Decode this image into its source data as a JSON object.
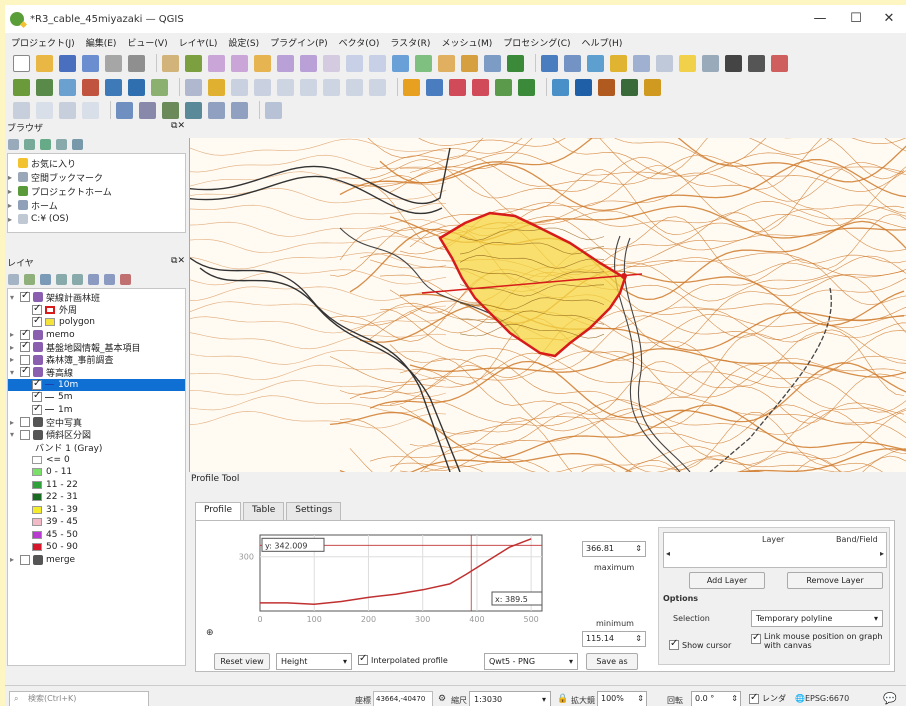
{
  "window": {
    "title": "*R3_cable_45miyazaki — QGIS",
    "minimize": "—",
    "maximize": "☐",
    "close": "✕"
  },
  "menu": [
    "プロジェクト(J)",
    "編集(E)",
    "ビュー(V)",
    "レイヤ(L)",
    "設定(S)",
    "プラグイン(P)",
    "ベクタ(O)",
    "ラスタ(R)",
    "メッシュ(M)",
    "プロセシング(C)",
    "ヘルプ(H)"
  ],
  "browser": {
    "title": "ブラウザ",
    "items": [
      "お気に入り",
      "空間ブックマーク",
      "プロジェクトホーム",
      "ホーム",
      "C:¥ (OS)"
    ]
  },
  "layers": {
    "title": "レイヤ",
    "rows": [
      {
        "label": "架線計画林班",
        "depth": 0,
        "checked": true,
        "expander": "▾",
        "icon": "#8a5fb0"
      },
      {
        "label": "外周",
        "depth": 1,
        "checked": true,
        "swatch": "outline-red"
      },
      {
        "label": "polygon",
        "depth": 1,
        "checked": true,
        "swatch": "#f3e33a"
      },
      {
        "label": "memo",
        "depth": 0,
        "checked": true,
        "expander": "▸",
        "icon": "#8a5fb0"
      },
      {
        "label": "基盤地図情報_基本項目",
        "depth": 0,
        "checked": true,
        "expander": "▸",
        "icon": "#8a5fb0"
      },
      {
        "label": "森林簿_事前調査",
        "depth": 0,
        "checked": false,
        "expander": "▸",
        "icon": "#8a5fb0"
      },
      {
        "label": "等高線",
        "depth": 0,
        "checked": true,
        "expander": "▾",
        "icon": "#8a5fb0"
      },
      {
        "label": "10m",
        "depth": 1,
        "checked": true,
        "selected": true,
        "line": "#1e40b0"
      },
      {
        "label": "5m",
        "depth": 1,
        "checked": true,
        "line": "#444444"
      },
      {
        "label": "1m",
        "depth": 1,
        "checked": true,
        "line": "#444444"
      },
      {
        "label": "空中写真",
        "depth": 0,
        "checked": false,
        "expander": "▸",
        "icon": "#555555"
      },
      {
        "label": "傾斜区分図",
        "depth": 0,
        "checked": false,
        "expander": "▾",
        "icon": "#555555"
      },
      {
        "label": "バンド 1 (Gray)",
        "depth": 1,
        "plain": true
      },
      {
        "label": "<= 0",
        "depth": 1,
        "swatch": "#ffffff"
      },
      {
        "label": "0 - 11",
        "depth": 1,
        "swatch": "#7be06a"
      },
      {
        "label": "11 - 22",
        "depth": 1,
        "swatch": "#2ea13a"
      },
      {
        "label": "22 - 31",
        "depth": 1,
        "swatch": "#196b22"
      },
      {
        "label": "31 - 39",
        "depth": 1,
        "swatch": "#f2ec2a"
      },
      {
        "label": "39 - 45",
        "depth": 1,
        "swatch": "#f2b9c7"
      },
      {
        "label": "45 - 50",
        "depth": 1,
        "swatch": "#b93ad0"
      },
      {
        "label": "50 - 90",
        "depth": 1,
        "swatch": "#d6162a"
      },
      {
        "label": "merge",
        "depth": 0,
        "checked": false,
        "expander": "▸",
        "icon": "#555555"
      }
    ]
  },
  "profile": {
    "title": "Profile Tool",
    "tabs": [
      "Profile",
      "Table",
      "Settings"
    ],
    "y_tick": "300",
    "x_ticks": [
      "0",
      "100",
      "200",
      "300",
      "400",
      "500"
    ],
    "cursor_y": "y: 342.009",
    "cursor_x": "x: 389.5",
    "max_value": "366.81",
    "max_label": "maximum",
    "min_label": "minimum",
    "min_value": "115.14",
    "reset_view": "Reset view",
    "mode": "Height",
    "interpolated": "Interpolated profile",
    "graph_lib": "Qwt5 - PNG",
    "save_as": "Save as",
    "layer_col": "Layer",
    "band_col": "Band/Field",
    "add_layer": "Add Layer",
    "remove_layer": "Remove Layer",
    "options": "Options",
    "selection_label": "Selection",
    "selection_value": "Temporary polyline",
    "show_cursor": "Show cursor",
    "link_mouse": "Link mouse position on graph with canvas",
    "chart_data": {
      "type": "line",
      "x": [
        0,
        50,
        100,
        150,
        200,
        250,
        300,
        350,
        380,
        420,
        460,
        500
      ],
      "y": [
        130,
        130,
        125,
        135,
        150,
        162,
        178,
        200,
        235,
        285,
        335,
        366
      ],
      "xlim": [
        0,
        520
      ],
      "ylim": [
        100,
        380
      ]
    }
  },
  "status": {
    "search_placeholder": "検索(Ctrl+K)",
    "coord_label": "座標",
    "coord_value": "43664,-40470",
    "scale_label": "縮尺",
    "scale_value": "1:3030",
    "magnifier_label": "拡大鏡",
    "magnifier_value": "100%",
    "rotation_label": "回転",
    "rotation_value": "0.0 °",
    "render_label": "レンダ",
    "epsg": "EPSG:6670"
  },
  "colors": {
    "accent": "#0f6fd2",
    "profile_line": "#c03030",
    "contour": "#cf7a2b",
    "polygon": "#f5d642",
    "polygon_edge": "#d71a1a"
  }
}
